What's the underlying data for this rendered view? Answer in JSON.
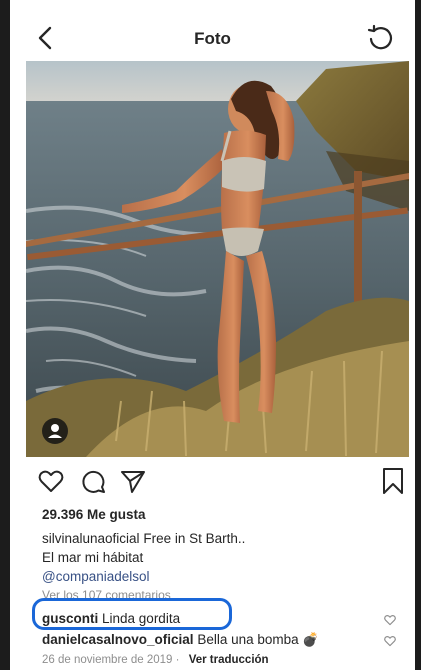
{
  "header": {
    "title": "Foto",
    "back_icon": "chevron-left-icon",
    "refresh_icon": "refresh-icon"
  },
  "post": {
    "image_alt": "Woman in a knit bikini leaning on a wooden rail above the sea at sunset",
    "likes": "29.396 Me gusta",
    "caption_user": "silvinalunaoficial",
    "caption_line1": "Free in St Barth..",
    "caption_line2": "El mar mi hábitat",
    "caption_mention": "@companiadelsol",
    "view_comments": "Ver los 107 comentarios",
    "date": "26 de noviembre de 2019",
    "translate": "Ver traducción"
  },
  "comments": [
    {
      "user": "gusconti",
      "text": "Linda gordita"
    },
    {
      "user": "danielcasalnovo_oficial",
      "text": "Bella una bomba 💣"
    }
  ],
  "colors": {
    "highlight": "#1a67d8",
    "mention": "#385185",
    "muted": "#8e8e8e"
  }
}
